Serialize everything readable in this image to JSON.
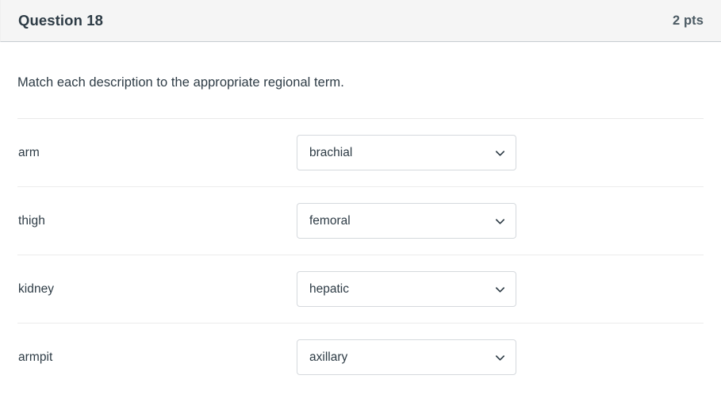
{
  "header": {
    "question_name": "Question 18",
    "points": "2 pts"
  },
  "body": {
    "question_text": "Match each description to the appropriate regional term.",
    "matches": [
      {
        "label": "arm",
        "selected": "brachial",
        "options": [
          "brachial",
          "femoral",
          "hepatic",
          "axillary"
        ]
      },
      {
        "label": "thigh",
        "selected": "femoral",
        "options": [
          "brachial",
          "femoral",
          "hepatic",
          "axillary"
        ]
      },
      {
        "label": "kidney",
        "selected": "hepatic",
        "options": [
          "brachial",
          "femoral",
          "hepatic",
          "axillary"
        ]
      },
      {
        "label": "armpit",
        "selected": "axillary",
        "options": [
          "brachial",
          "femoral",
          "hepatic",
          "axillary"
        ]
      }
    ]
  },
  "icons": {
    "select_chevron": "chevron-down-icon"
  },
  "colors": {
    "header_background": "#f5f5f5",
    "header_border": "#c7cdd1",
    "text": "#2d3b45",
    "divider": "#ececec",
    "select_border": "#d5d9dd",
    "page_background": "#ffffff"
  }
}
